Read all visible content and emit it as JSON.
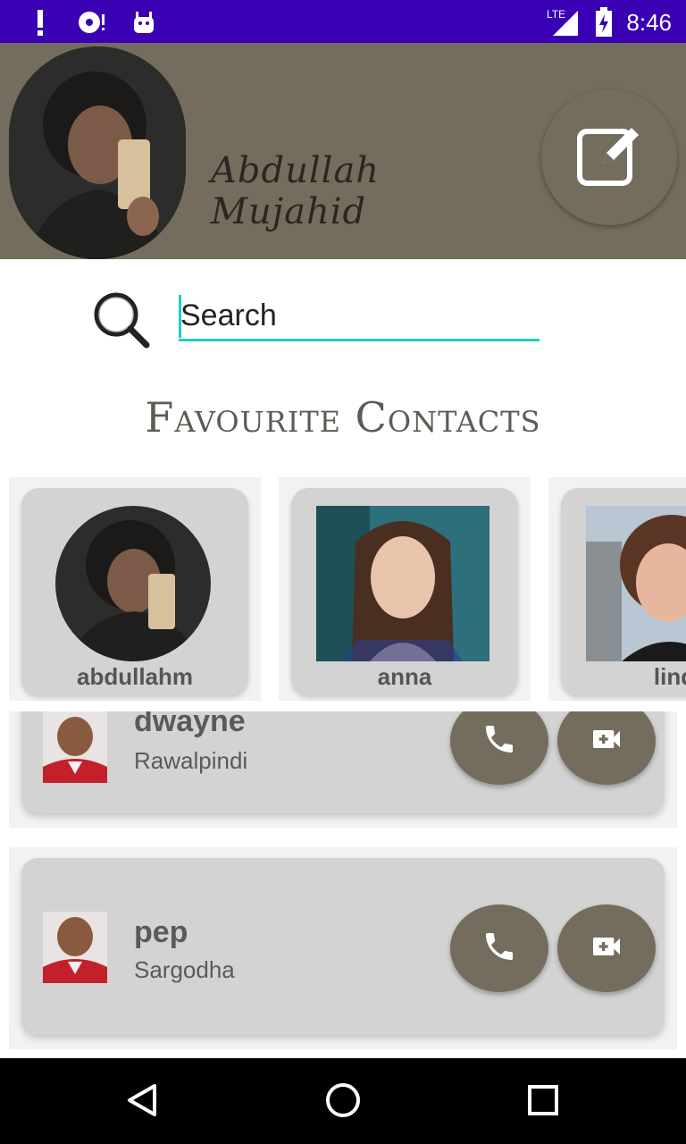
{
  "status_bar": {
    "time": "8:46",
    "network": "LTE",
    "icons": [
      "alert-icon",
      "media-icon",
      "android-icon",
      "signal-icon",
      "battery-charging-icon"
    ]
  },
  "header": {
    "user_name": "Abdullah Mujahid",
    "edit_icon": "edit-icon",
    "background_color": "#746d5e"
  },
  "search": {
    "placeholder": "Search",
    "value": "",
    "accent_color": "#1ccfc4"
  },
  "favourites": {
    "heading": "Favourite Contacts",
    "items": [
      {
        "name": "abdullahm"
      },
      {
        "name": "anna"
      },
      {
        "name": "lind"
      }
    ]
  },
  "contacts": [
    {
      "name": "dwayne",
      "city": "Rawalpindi"
    },
    {
      "name": "pep",
      "city": "Sargodha"
    }
  ],
  "actions": {
    "call_icon": "phone-icon",
    "video_icon": "video-call-icon"
  },
  "nav": {
    "icons": [
      "back-icon",
      "home-icon",
      "recents-icon"
    ]
  }
}
